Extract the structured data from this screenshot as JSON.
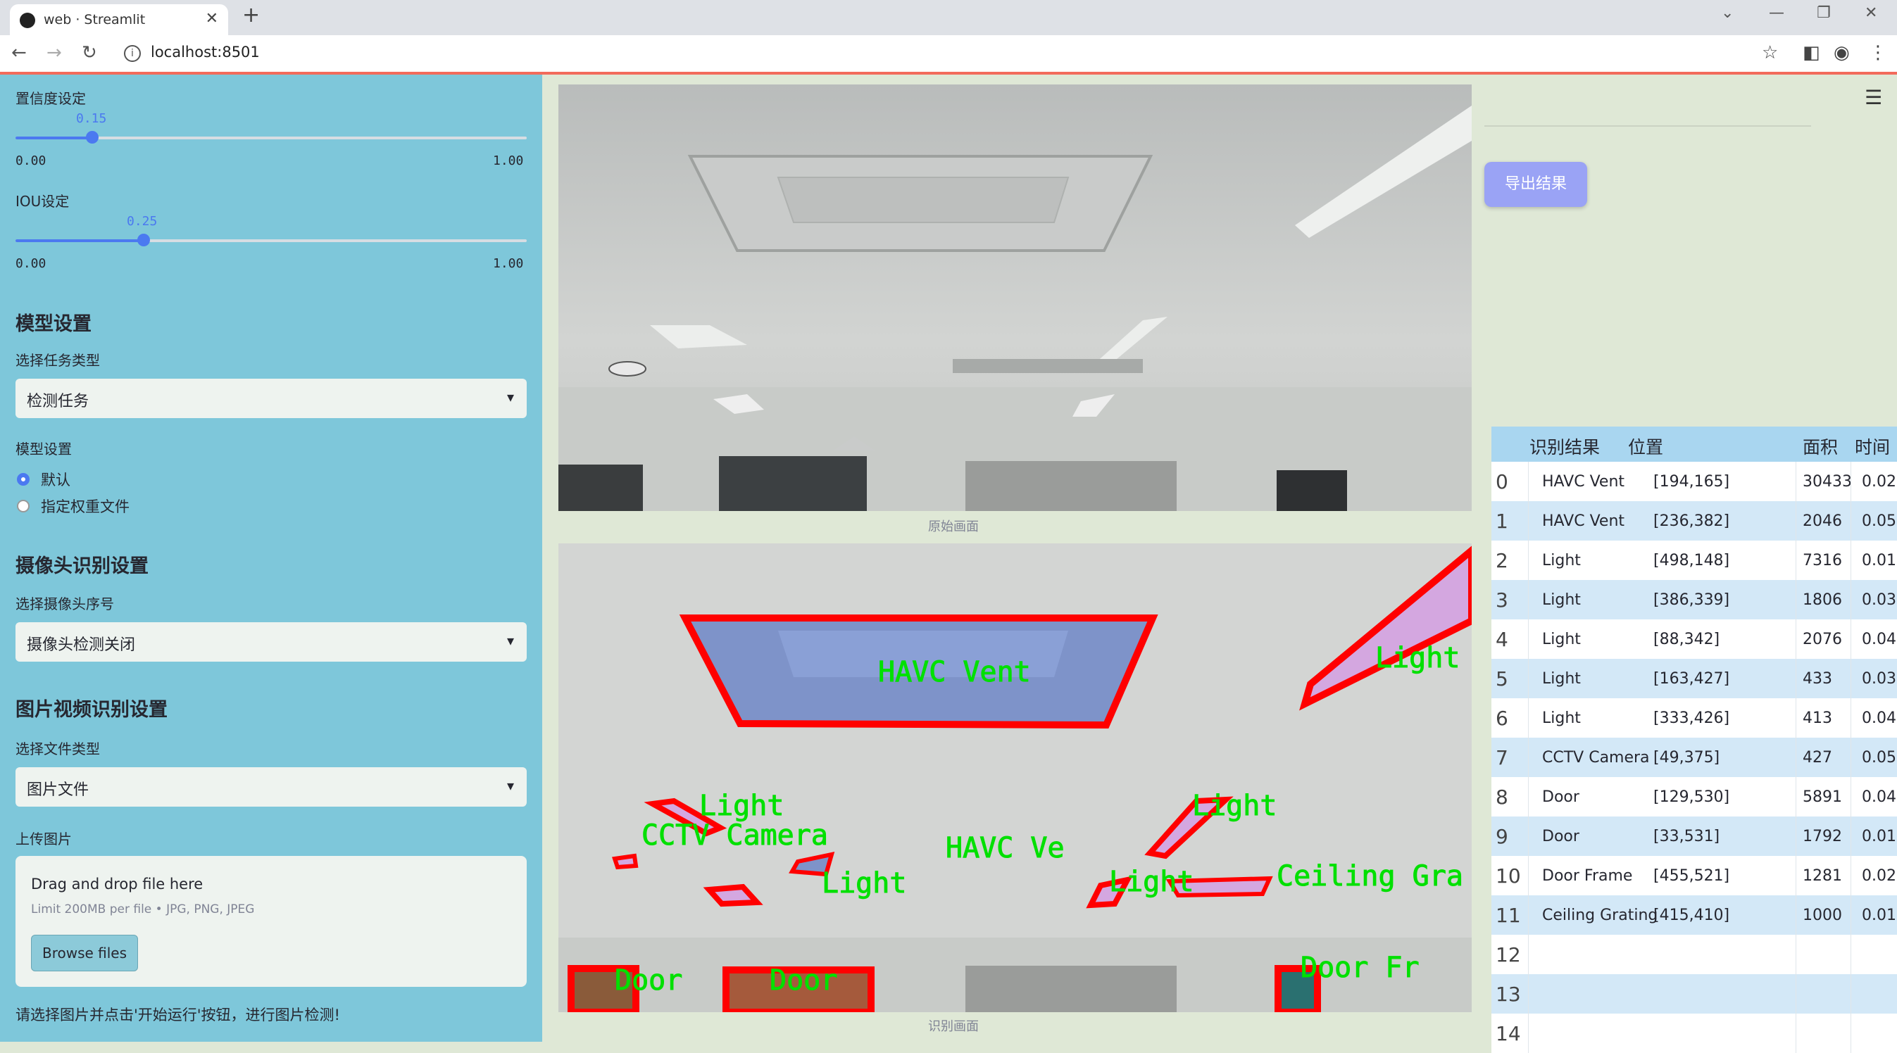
{
  "browser": {
    "tab_title": "web · Streamlit",
    "url": "localhost:8501"
  },
  "sidebar": {
    "confidence": {
      "label": "置信度设定",
      "value": "0.15",
      "level": 0.15,
      "min": "0.00",
      "max": "1.00"
    },
    "iou": {
      "label": "IOU设定",
      "value": "0.25",
      "level": 0.25,
      "min": "0.00",
      "max": "1.00"
    },
    "model_section": "模型设置",
    "task_label": "选择任务类型",
    "task_value": "检测任务",
    "model_label": "模型设置",
    "model_options": [
      "默认",
      "指定权重文件"
    ],
    "model_selected": 0,
    "camera_section": "摄像头识别设置",
    "camera_label": "选择摄像头序号",
    "camera_value": "摄像头检测关闭",
    "media_section": "图片视频识别设置",
    "filetype_label": "选择文件类型",
    "filetype_value": "图片文件",
    "upload_label": "上传图片",
    "upload_title": "Drag and drop file here",
    "upload_limit": "Limit 200MB per file • JPG, PNG, JPEG",
    "browse_label": "Browse files",
    "hint": "请选择图片并点击'开始运行'按钮，进行图片检测!"
  },
  "main": {
    "original_caption": "原始画面",
    "result_caption": "识别画面",
    "export_label": "导出结果",
    "overlay_labels": [
      "HAVC  Vent",
      "Light",
      "Light",
      "CCTV  Camera",
      "HAVC  Ve",
      "Light",
      "Light",
      "Light",
      "Ceiling  Gra",
      "Door",
      "Door",
      "Door  Fr"
    ]
  },
  "table": {
    "headers": [
      "识别结果",
      "位置",
      "面积",
      "时间"
    ],
    "rows": [
      {
        "i": "0",
        "name": "HAVC Vent",
        "pos": "[194,165]",
        "area": "30433",
        "time": "0.02"
      },
      {
        "i": "1",
        "name": "HAVC Vent",
        "pos": "[236,382]",
        "area": "2046",
        "time": "0.05"
      },
      {
        "i": "2",
        "name": "Light",
        "pos": "[498,148]",
        "area": "7316",
        "time": "0.01"
      },
      {
        "i": "3",
        "name": "Light",
        "pos": "[386,339]",
        "area": "1806",
        "time": "0.03"
      },
      {
        "i": "4",
        "name": "Light",
        "pos": "[88,342]",
        "area": "2076",
        "time": "0.04"
      },
      {
        "i": "5",
        "name": "Light",
        "pos": "[163,427]",
        "area": "433",
        "time": "0.03"
      },
      {
        "i": "6",
        "name": "Light",
        "pos": "[333,426]",
        "area": "413",
        "time": "0.04"
      },
      {
        "i": "7",
        "name": "CCTV Camera",
        "pos": "[49,375]",
        "area": "427",
        "time": "0.05"
      },
      {
        "i": "8",
        "name": "Door",
        "pos": "[129,530]",
        "area": "5891",
        "time": "0.04"
      },
      {
        "i": "9",
        "name": "Door",
        "pos": "[33,531]",
        "area": "1792",
        "time": "0.01"
      },
      {
        "i": "10",
        "name": "Door Frame",
        "pos": "[455,521]",
        "area": "1281",
        "time": "0.02"
      },
      {
        "i": "11",
        "name": "Ceiling Grating",
        "pos": "[415,410]",
        "area": "1000",
        "time": "0.01"
      },
      {
        "i": "12",
        "name": "",
        "pos": "",
        "area": "",
        "time": ""
      },
      {
        "i": "13",
        "name": "",
        "pos": "",
        "area": "",
        "time": ""
      },
      {
        "i": "14",
        "name": "",
        "pos": "",
        "area": "",
        "time": ""
      }
    ]
  },
  "colors": {
    "accent": "#4b79f0",
    "sidebar": "#7ec7da",
    "detection_box": "#ff0000",
    "detection_text": "#00e000"
  }
}
